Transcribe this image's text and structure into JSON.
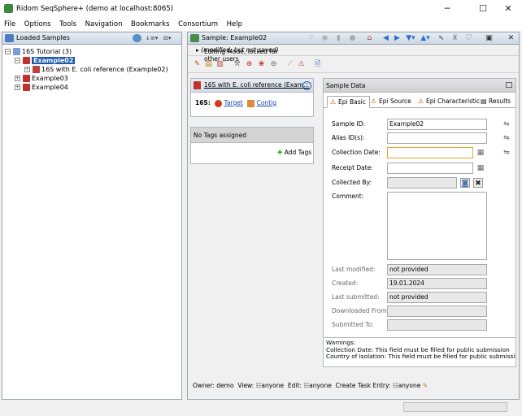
{
  "window": {
    "title": "Ridom SeqSphere+ (demo at localhost:8065)",
    "minimize": "─",
    "maximize": "☐",
    "close": "✕"
  },
  "menu": [
    "File",
    "Options",
    "Tools",
    "Navigation",
    "Bookmarks",
    "Consortium",
    "Help"
  ],
  "left_panel": {
    "title": "Loaded Samples",
    "tree": [
      {
        "label": "16S Tutorial (3)",
        "toggle": "−"
      },
      {
        "label": "Example02",
        "toggle": "−",
        "selected": true
      },
      {
        "label": "16S with E. coli reference (Example02)",
        "toggle": "+"
      },
      {
        "label": "Example03",
        "toggle": "+"
      },
      {
        "label": "Example04",
        "toggle": "+"
      }
    ]
  },
  "right_panel": {
    "title": "Sample: Example02",
    "editing_mode": "Editing Mode, locked for other users",
    "editing_note": "(modified, but not saved)",
    "card1": {
      "title": "16S with E. coli reference (Exam...",
      "row_label": "16S:",
      "target_link": "Target",
      "contig_link": "Contig"
    },
    "card2": {
      "title": "No Tags assigned",
      "add_tags": "Add Tags"
    },
    "sample_data": {
      "title": "Sample Data",
      "tabs": [
        "Epi Basic",
        "Epi Source",
        "Epi Characteristic",
        "Results"
      ],
      "fields": {
        "sample_id": {
          "label": "Sample ID:",
          "value": "Example02"
        },
        "alias_ids": {
          "label": "Alias ID(s):",
          "value": ""
        },
        "collection_date": {
          "label": "Collection Date:",
          "value": ""
        },
        "receipt_date": {
          "label": "Receipt Date:",
          "value": ""
        },
        "collected_by": {
          "label": "Collected By:",
          "value": ""
        },
        "comment": {
          "label": "Comment:",
          "value": ""
        },
        "last_modified": {
          "label": "Last modified:",
          "value": "not provided"
        },
        "created": {
          "label": "Created:",
          "value": "19.01.2024"
        },
        "last_submitted": {
          "label": "Last submitted:",
          "value": "not provided"
        },
        "downloaded_from": {
          "label": "Downloaded From:",
          "value": ""
        },
        "submitted_to": {
          "label": "Submitted To:",
          "value": ""
        }
      },
      "warnings": {
        "title": "Warnings:",
        "lines": [
          "Collection Date: This field must be filled for public submission",
          "Country of Isolation: This field must be filled for public submission"
        ]
      }
    },
    "owner": {
      "owner_label": "Owner: demo",
      "view_label": "View:",
      "view_value": "anyone",
      "edit_label": "Edit:",
      "edit_value": "anyone",
      "task_label": "Create Task Entry:",
      "task_value": "anyone"
    }
  },
  "colors": {
    "selection": "#1a5aa8",
    "focus_border": "#e8a326",
    "link": "#1a3fb0",
    "warning_icon": "#d64a00"
  }
}
